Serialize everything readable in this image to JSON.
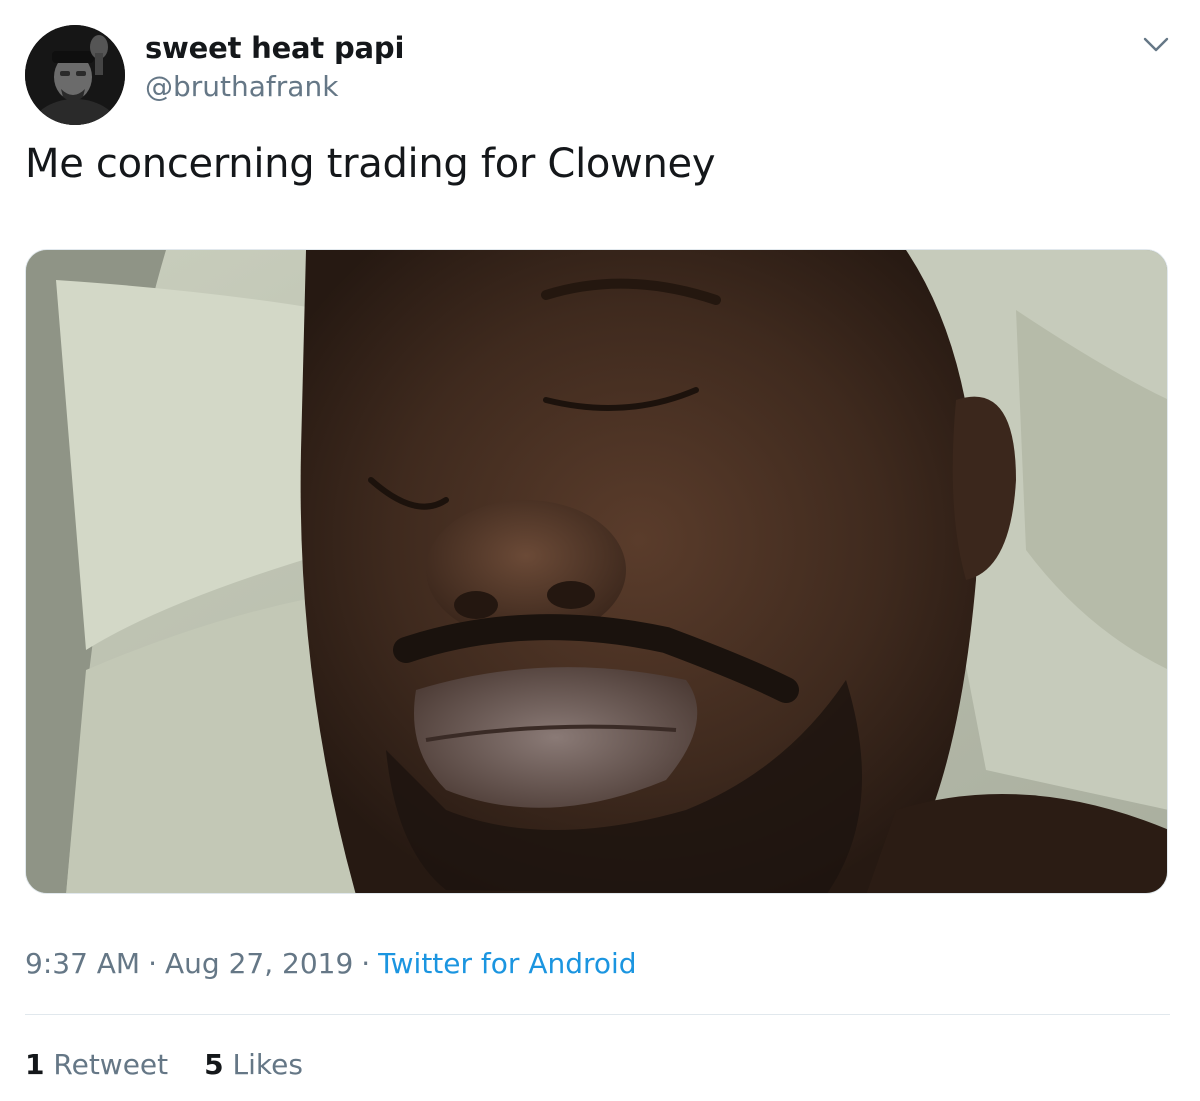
{
  "author": {
    "display_name": "sweet heat papi",
    "handle": "@bruthafrank",
    "avatar_icon": "person-photo"
  },
  "tweet": {
    "text": "Me concerning trading for Clowney",
    "media_icon": "photo-man-sleeping-on-pillow"
  },
  "meta": {
    "time": "9:37 AM",
    "separator": "·",
    "date": "Aug 27, 2019",
    "source": "Twitter for Android"
  },
  "stats": {
    "retweets_count": "1",
    "retweets_label": "Retweet",
    "likes_count": "5",
    "likes_label": "Likes"
  },
  "colors": {
    "text_primary": "#14171a",
    "text_secondary": "#657786",
    "link": "#1b95e0",
    "border": "#e1e8ed"
  },
  "icons": {
    "menu": "chevron-down-icon"
  }
}
